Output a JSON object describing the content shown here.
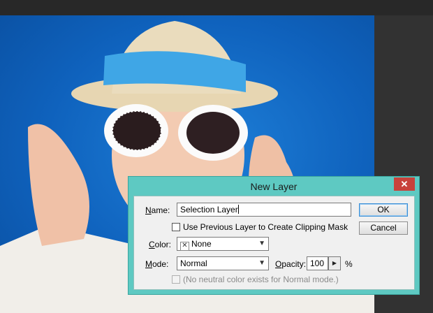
{
  "dialog": {
    "title": "New Layer",
    "close_glyph": "✕",
    "name_label": "Name:",
    "name_label_accel": "N",
    "name_label_rest": "ame:",
    "name_value": "Selection Layer",
    "ok_label": "OK",
    "cancel_label": "Cancel",
    "clip_label": "Use Previous Layer to Create Clipping Mask",
    "clip_checked": false,
    "color_label_accel": "C",
    "color_label_rest": "olor:",
    "color_swatch": "✕",
    "color_value": "None",
    "mode_label_accel": "M",
    "mode_label_rest": "ode:",
    "mode_value": "Normal",
    "opacity_label_accel": "O",
    "opacity_label_rest": "pacity:",
    "opacity_value": "100",
    "opacity_unit": "%",
    "neutral_label": "(No neutral color exists for Normal mode.)",
    "neutral_enabled": false
  },
  "colors": {
    "dialog_frame": "#5ec9c2",
    "close_button": "#c8423b",
    "canvas_bg": "#0f62bd",
    "default_button_border": "#3b8fd6"
  },
  "icons": {
    "close": "close-icon",
    "dropdown": "chevron-down-icon",
    "stepper": "chevron-right-icon"
  }
}
